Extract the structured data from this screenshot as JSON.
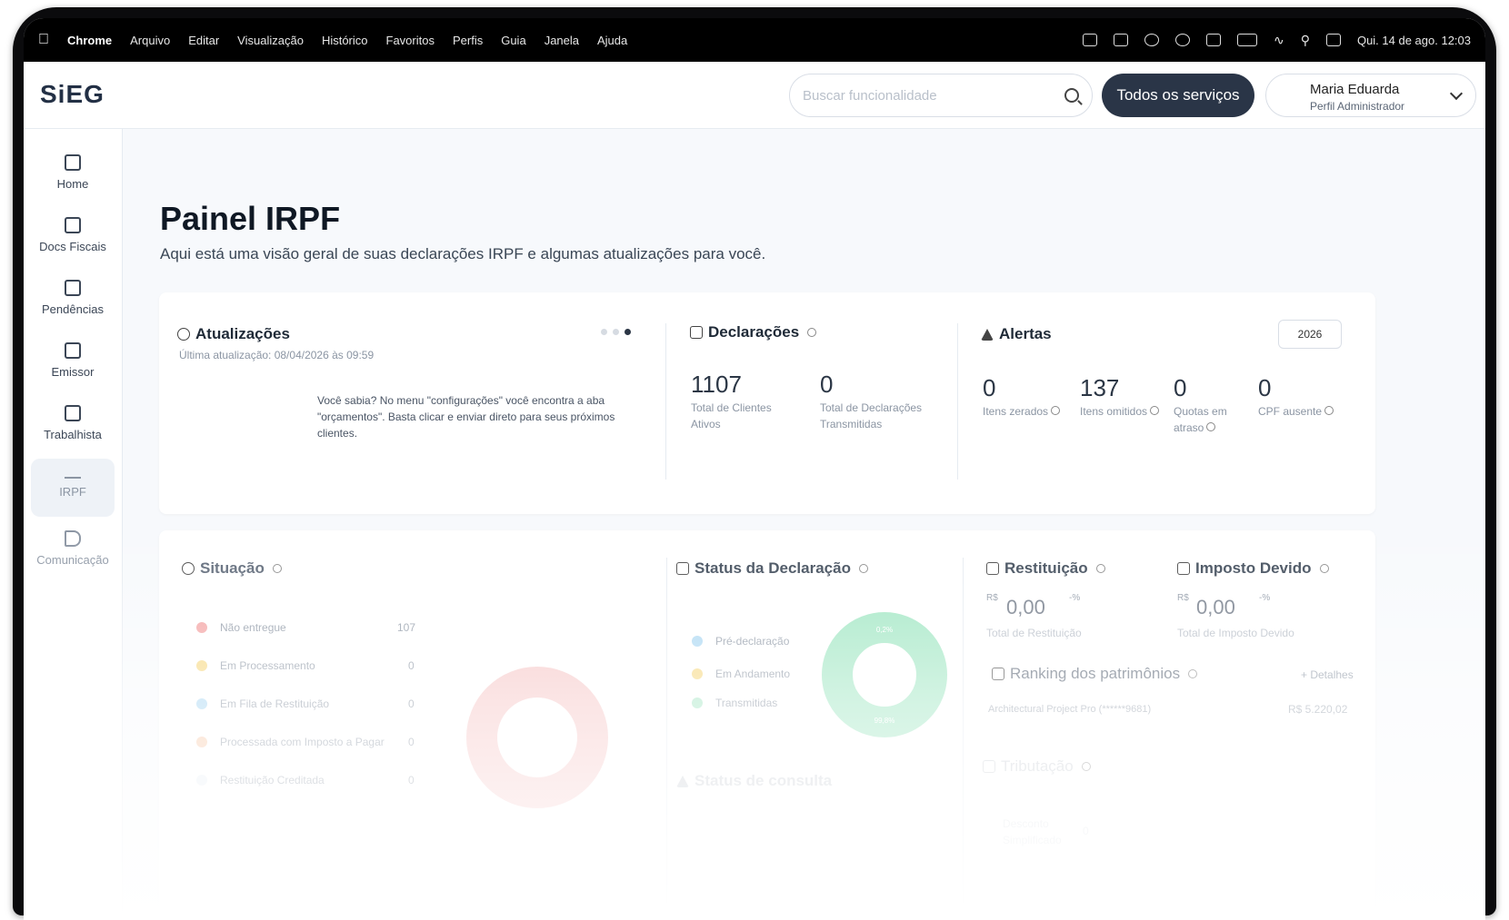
{
  "menubar": {
    "app": "Chrome",
    "items": [
      "Arquivo",
      "Editar",
      "Visualização",
      "Histórico",
      "Favoritos",
      "Perfis",
      "Guia",
      "Janela",
      "Ajuda"
    ],
    "datetime": "Qui. 14 de ago.  12:03"
  },
  "header": {
    "logo": "SiEG",
    "search_placeholder": "Buscar funcionalidade",
    "all_services": "Todos os serviços",
    "user_name": "Maria Eduarda",
    "user_role": "Perfil Administrador"
  },
  "sidebar": {
    "items": [
      {
        "label": "Home",
        "icon": "home-icon"
      },
      {
        "label": "Docs Fiscais",
        "icon": "document-icon"
      },
      {
        "label": "Pendências",
        "icon": "calendar-check-icon"
      },
      {
        "label": "Emissor",
        "icon": "arrow-in-box-icon"
      },
      {
        "label": "Trabalhista",
        "icon": "id-card-icon"
      },
      {
        "label": "IRPF",
        "icon": "list-search-icon"
      },
      {
        "label": "Comunicação",
        "icon": "send-icon"
      }
    ]
  },
  "page": {
    "title": "Painel IRPF",
    "subtitle": "Aqui está uma visão geral de suas declarações IRPF e algumas atualizações para você."
  },
  "updates": {
    "title": "Atualizações",
    "last_update": "Última atualização: 08/04/2026 às 09:59",
    "tip": "Você sabia? No menu \"configurações\" você encontra a aba \"orçamentos\". Basta clicar e enviar direto para seus próximos clientes."
  },
  "declarations": {
    "title": "Declarações",
    "total_clients_value": "1107",
    "total_clients_label": "Total de Clientes Ativos",
    "total_transmitted_value": "0",
    "total_transmitted_label": "Total de Declarações Transmitidas"
  },
  "alerts": {
    "title": "Alertas",
    "year": "2026",
    "items": [
      {
        "value": "0",
        "label": "Itens zerados"
      },
      {
        "value": "137",
        "label": "Itens omitidos"
      },
      {
        "value": "0",
        "label": "Quotas em atraso"
      },
      {
        "value": "0",
        "label": "CPF ausente"
      }
    ]
  },
  "situacao": {
    "title": "Situação",
    "rows": [
      {
        "label": "Não entregue",
        "value": "107",
        "color": "#f3a0a0"
      },
      {
        "label": "Em Processamento",
        "value": "0",
        "color": "#f6d77e"
      },
      {
        "label": "Em Fila de Restituição",
        "value": "0",
        "color": "#a8d6f2"
      },
      {
        "label": "Processada com Imposto a Pagar",
        "value": "0",
        "color": "#f8c9a8"
      },
      {
        "label": "Restituição Creditada",
        "value": "0",
        "color": "#e8eef4"
      },
      {
        "label": "",
        "value": "0",
        "color": "#eef2f6"
      }
    ]
  },
  "status_declaracao": {
    "title": "Status da Declaração",
    "rows": [
      {
        "label": "Pré-declaração",
        "color": "#a8d6f2"
      },
      {
        "label": "Em Andamento",
        "color": "#f6d77e"
      },
      {
        "label": "Transmitidas",
        "color": "#a8e6c6"
      }
    ],
    "donut_top_label": "0,2%",
    "donut_bottom_label": "99,8%"
  },
  "status_consulta": {
    "title": "Status de consulta"
  },
  "restituicao": {
    "title": "Restituição",
    "currency": "R$",
    "value": "0,00",
    "pct": "-%",
    "label": "Total de Restituição"
  },
  "imposto": {
    "title": "Imposto Devido",
    "currency": "R$",
    "value": "0,00",
    "pct": "-%",
    "label": "Total de Imposto Devido"
  },
  "ranking": {
    "title": "Ranking dos patrimônios",
    "details": "+ Detalhes",
    "item_label": "Architectural Project Pro (******9681)",
    "item_value": "R$ 5.220,02"
  },
  "tributacao": {
    "title": "Tributação",
    "item_label": "Desconto Simplificado",
    "item_value": "0"
  },
  "colors": {
    "accent_dark": "#2a3547",
    "donut_red": "#f6c6c6",
    "donut_green": "#9fe6c2"
  }
}
